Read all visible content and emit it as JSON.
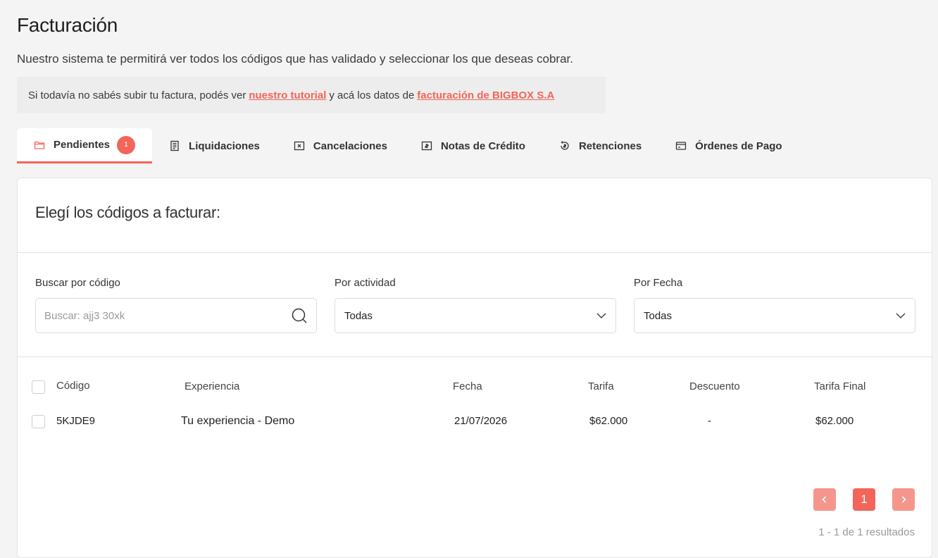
{
  "header": {
    "title": "Facturación",
    "subtitle": "Nuestro sistema te permitirá ver todos los códigos que has validado y seleccionar los que deseas cobrar."
  },
  "info": {
    "text_before": "Si todavía no sabés subir tu factura, podés ver",
    "tutorial_link": "nuestro tutorial",
    "text_middle": "y acá los datos de",
    "billing_link": "facturación de BIGBOX S.A"
  },
  "tabs": [
    {
      "label": "Pendientes",
      "icon": "folder-icon",
      "badge": "1",
      "active": true
    },
    {
      "label": "Liquidaciones",
      "icon": "receipt-icon"
    },
    {
      "label": "Cancelaciones",
      "icon": "cancel-box-icon"
    },
    {
      "label": "Notas de Crédito",
      "icon": "credit-note-icon"
    },
    {
      "label": "Retenciones",
      "icon": "retention-icon"
    },
    {
      "label": "Órdenes de Pago",
      "icon": "payment-card-icon"
    }
  ],
  "card": {
    "title": "Elegí los códigos a facturar:"
  },
  "filters": {
    "search": {
      "label": "Buscar por código",
      "placeholder": "Buscar: ajj3 30xk"
    },
    "activity": {
      "label": "Por actividad",
      "value": "Todas"
    },
    "date": {
      "label": "Por Fecha",
      "value": "Todas"
    }
  },
  "table": {
    "columns": [
      "Código",
      "Experiencia",
      "Fecha",
      "Tarifa",
      "Descuento",
      "Tarifa Final"
    ],
    "rows": [
      [
        "5KJDE9",
        "Tu experiencia - Demo",
        "21/07/2026",
        "$62.000",
        "-",
        "$62.000"
      ]
    ]
  },
  "pagination": {
    "prev": "‹",
    "current": "1",
    "next": "›",
    "results": "1 - 1 de 1 resultados"
  },
  "colors": {
    "accent": "#f2655a",
    "accent_light": "#f5968c",
    "background": "#f4f4f4"
  }
}
